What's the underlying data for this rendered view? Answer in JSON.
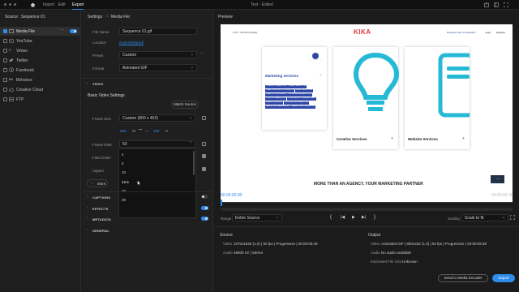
{
  "window": {
    "title": "Test - Edited"
  },
  "nav": {
    "tabs": [
      "Import",
      "Edit",
      "Export"
    ],
    "active": "Export"
  },
  "source": {
    "label": "Source:",
    "value": "Sequence 01"
  },
  "destinations": [
    {
      "label": "Media File",
      "checked": true,
      "selected": true
    },
    {
      "label": "YouTube",
      "checked": false
    },
    {
      "label": "Vimeo",
      "checked": false
    },
    {
      "label": "Twitter",
      "checked": false
    },
    {
      "label": "Facebook",
      "checked": false
    },
    {
      "label": "Behance",
      "checked": false
    },
    {
      "label": "Creative Cloud",
      "checked": false
    },
    {
      "label": "FTP",
      "checked": false
    }
  ],
  "settings": {
    "header": "Settings",
    "media_file": "Media File",
    "file_name_label": "File Name",
    "file_name": "Sequence 01.gif",
    "location_label": "Location",
    "location": "/Users/Shared/",
    "preset_label": "Preset",
    "preset": "Custom",
    "format_label": "Format",
    "format": "Animated GIF",
    "video_section": "VIDEO",
    "basic_title": "Basic Video Settings",
    "match_source": "Match Source",
    "frame_size_label": "Frame Size",
    "frame_size": "Custom (800 x 462)",
    "width": "800",
    "height": "462",
    "w_label": "W",
    "h_label": "H",
    "frame_rate_label": "Frame Rate",
    "frame_rate": "50",
    "field_order_label": "Field Order",
    "aspect_label": "Aspect",
    "more": "More",
    "rate_options": [
      "4",
      "5",
      "10",
      "12.5",
      "20",
      "25"
    ],
    "sections": [
      "CAPTIONS",
      "EFFECTS",
      "METADATA",
      "GENERAL"
    ]
  },
  "preview": {
    "label": "Preview",
    "website": {
      "phone": "1 877 730 KIKA (5452)",
      "logo": "KIKA",
      "consult": "Request Free Consultation",
      "login": "Login",
      "register": "Register",
      "card1_title": "Marketing Services",
      "card1_tags": [
        "STRATEGY MARKETING",
        "BRAND MARKETING",
        "SEARCH ENGINE OPTIMIZATION",
        "EMAIL MARKETING",
        "SEARCH + SOCIAL ADS",
        "SOCIAL MEDIA MARKETING",
        "CONTENT MARKETING",
        "CONVERSION + FUNNEL PLANS",
        "MARKETING AUDIT",
        "EXPERIENTIAL MARKETING",
        "MARKETING MANAGEMENT",
        "MARKETING CONSULTING"
      ],
      "card2_title": "Creative Services",
      "card3_title": "Website Services",
      "tagline": "MORE THAN AN AGENCY, YOUR MARKETING PARTNER"
    },
    "timecode_in": "00:00:00:00",
    "timecode_out": "00:00:09:38",
    "range_label": "Range",
    "range": "Entire Source",
    "scaling_label": "Scaling",
    "scaling": "Scale to fit"
  },
  "source_info": {
    "heading": "Source",
    "video_label": "Video",
    "video": "1070x1946 (1.0)  |  50 fps  |  Progressive  |  00:00:09:46",
    "audio_label": "Audio",
    "audio": "48000 Hz  |  Stereo"
  },
  "output_info": {
    "heading": "Output",
    "video_label": "Video",
    "video": "Animated GIF  |  800x462 (1.0)  |  50 fps  |  Progressive  |  00:00:09:38",
    "audio_label": "Audio",
    "audio": "No audio available",
    "size_label": "Estimated File Size",
    "size": "Unknown"
  },
  "buttons": {
    "send": "Send to Media Encoder",
    "export": "Export"
  },
  "colors": {
    "accent": "#2d8ceb",
    "kika_red": "#e2363b",
    "kika_cyan": "#25b9d6"
  }
}
